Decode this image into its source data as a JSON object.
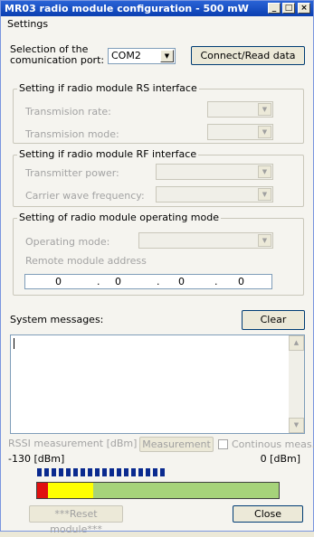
{
  "window": {
    "title": "MR03 radio module configuration - 500 mW",
    "minimize": "_",
    "maximize": "□",
    "close": "×"
  },
  "menu": [
    "Settings"
  ],
  "port": {
    "label_line1": "Selection of the",
    "label_line2": "comunication port:",
    "value": "COM2",
    "connect_label": "Connect/Read data"
  },
  "rs_group": {
    "caption": "Setting if radio module RS interface",
    "rate_label": "Transmision rate:",
    "mode_label": "Transmision mode:"
  },
  "rf_group": {
    "caption": "Setting if radio module RF interface",
    "power_label": "Transmitter power:",
    "freq_label": "Carrier wave frequency:"
  },
  "op_group": {
    "caption": "Setting of radio module operating mode",
    "mode_label": "Operating mode:",
    "address_label": "Remote module address",
    "address": [
      "0",
      "0",
      "0",
      "0"
    ],
    "dot": "."
  },
  "messages": {
    "label": "System messages:",
    "clear_label": "Clear",
    "text": ""
  },
  "rssi": {
    "label": "RSSI measurement [dBm]",
    "measure_label": "Measurement",
    "continous_label": "Continous meas.",
    "min_label": "-130 [dBm]",
    "max_label": "0  [dBm]",
    "level_segments": 18,
    "meter_colors": [
      "#e01010",
      "#ffff00",
      "#a6d37a"
    ]
  },
  "footer": {
    "reset_label": "***Reset module***",
    "close_label": "Close"
  }
}
